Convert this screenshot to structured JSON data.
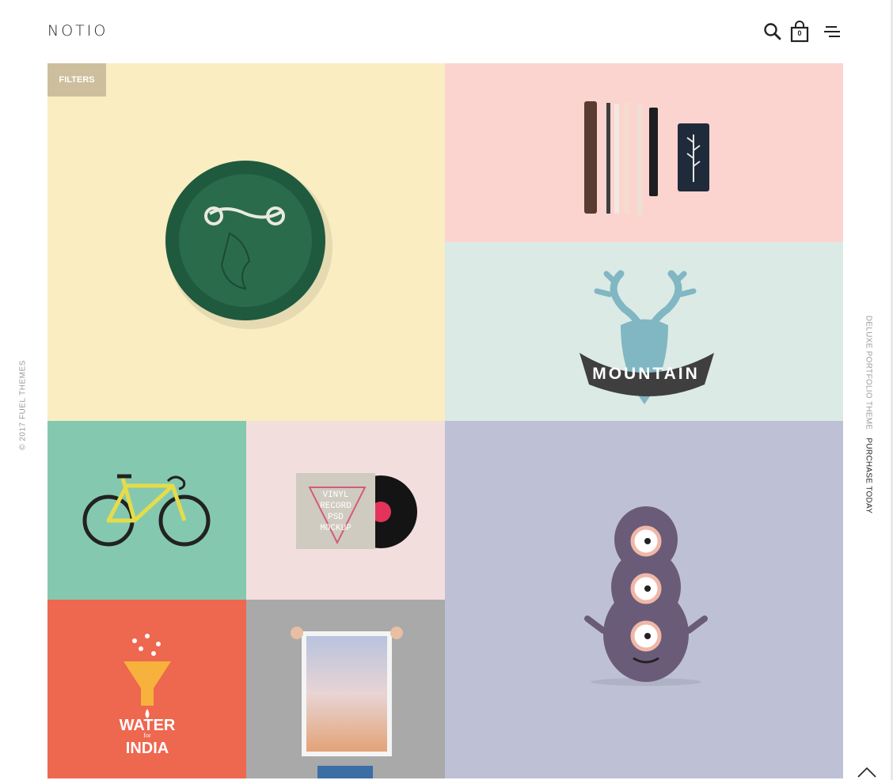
{
  "header": {
    "logo": "NOTIO",
    "cart_count": "0",
    "icons": [
      "search-icon",
      "cart-icon",
      "menu-icon"
    ]
  },
  "filters_label": "FILTERS",
  "side": {
    "copyright": "© 2017 FUEL THEMES",
    "tagline": "DELUXE PORTFOLIO THEME",
    "cta": "PURCHASE TODAY"
  },
  "portfolio": {
    "items": [
      {
        "artwork": "pin-button",
        "bg": "#f9edc1"
      },
      {
        "artwork": "pencils-stationery",
        "bg": "#fcd4cf"
      },
      {
        "artwork": "mountain-deer-logo",
        "bg": "#dbeae5",
        "text": "MOUNTAIN"
      },
      {
        "artwork": "bicycle",
        "bg": "#85c8b0"
      },
      {
        "artwork": "vinyl-record-mockup",
        "bg": "#f3dede",
        "text": [
          "VINYL",
          "RECORD",
          "PSD",
          "MOCKUP"
        ]
      },
      {
        "artwork": "monster",
        "bg": "#bec1d6"
      },
      {
        "artwork": "water-india-logo",
        "bg": "#ee674f",
        "text": [
          "WATER",
          "INDIA"
        ],
        "small_text": "for"
      },
      {
        "artwork": "poster-mockup",
        "bg": "#a9a9a9"
      }
    ]
  },
  "colors": {
    "accent": "#cdbf9d",
    "text": "#222222",
    "muted": "#9a9a9a"
  }
}
